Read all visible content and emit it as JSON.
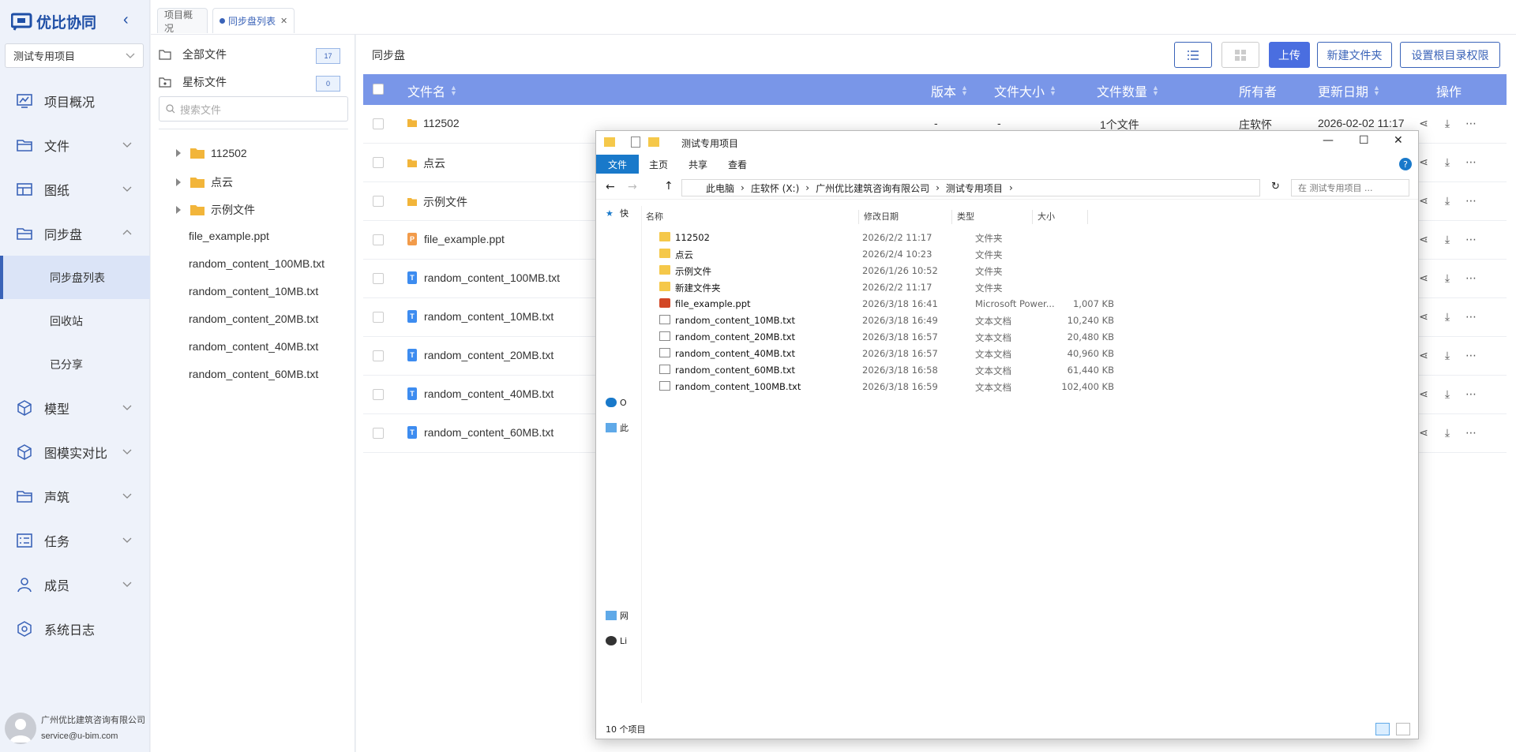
{
  "app": {
    "logo_text": "优比协同",
    "project": "测试专用项目"
  },
  "nav": [
    {
      "label": "项目概况",
      "icon": "chart-icon"
    },
    {
      "label": "文件",
      "icon": "folder-icon"
    },
    {
      "label": "图纸",
      "icon": "drawing-icon"
    },
    {
      "label": "同步盘",
      "icon": "sync-icon"
    },
    {
      "label": "模型",
      "icon": "cube-icon"
    },
    {
      "label": "图模实对比",
      "icon": "compare-icon"
    },
    {
      "label": "声筑",
      "icon": "sound-icon"
    },
    {
      "label": "任务",
      "icon": "task-icon"
    },
    {
      "label": "成员",
      "icon": "user-icon"
    },
    {
      "label": "系统日志",
      "icon": "log-icon"
    }
  ],
  "sync_sub": [
    "同步盘列表",
    "回收站",
    "已分享"
  ],
  "user": {
    "company": "广州优比建筑咨询有限公司",
    "email": "service@u-bim.com"
  },
  "tabs": [
    {
      "label": "项目概况"
    },
    {
      "label": "同步盘列表"
    }
  ],
  "tree": {
    "all_files": "全部文件",
    "all_count": "17",
    "starred": "星标文件",
    "starred_count": "0",
    "search_placeholder": "搜索文件",
    "nodes": [
      "112502",
      "点云",
      "示例文件"
    ],
    "files": [
      "file_example.ppt",
      "random_content_100MB.txt",
      "random_content_10MB.txt",
      "random_content_20MB.txt",
      "random_content_40MB.txt",
      "random_content_60MB.txt"
    ]
  },
  "main": {
    "breadcrumb": "同步盘",
    "btn_upload": "上传",
    "btn_new_folder": "新建文件夹",
    "btn_root_perm": "设置根目录权限",
    "headers": {
      "name": "文件名",
      "version": "版本",
      "size": "文件大小",
      "count": "文件数量",
      "owner": "所有者",
      "updated": "更新日期",
      "ops": "操作"
    },
    "row0": {
      "name": "112502",
      "version": "-",
      "size": "-",
      "count": "1个文件",
      "owner": "庄软怀",
      "updated": "2026-02-02 11:17"
    },
    "rows": [
      "点云",
      "示例文件",
      "file_example.ppt",
      "random_content_100MB.txt",
      "random_content_10MB.txt",
      "random_content_20MB.txt",
      "random_content_40MB.txt",
      "random_content_60MB.txt"
    ]
  },
  "explorer": {
    "title": "测试专用项目",
    "ribbon": [
      "文件",
      "主页",
      "共享",
      "查看"
    ],
    "path": [
      "此电脑",
      "庄软怀 (X:)",
      "广州优比建筑咨询有限公司",
      "测试专用项目"
    ],
    "search_placeholder": "在 测试专用项目 ...",
    "columns": {
      "name": "名称",
      "date": "修改日期",
      "type": "类型",
      "size": "大小"
    },
    "nav_labels": {
      "quick": "快",
      "onedrive": "O",
      "pc": "此",
      "network": "网",
      "linux": "Li"
    },
    "files": [
      {
        "name": "112502",
        "date": "2026/2/2 11:17",
        "type": "文件夹",
        "size": ""
      },
      {
        "name": "点云",
        "date": "2026/2/4 10:23",
        "type": "文件夹",
        "size": ""
      },
      {
        "name": "示例文件",
        "date": "2026/1/26 10:52",
        "type": "文件夹",
        "size": ""
      },
      {
        "name": "新建文件夹",
        "date": "2026/2/2 11:17",
        "type": "文件夹",
        "size": ""
      },
      {
        "name": "file_example.ppt",
        "date": "2026/3/18 16:41",
        "type": "Microsoft Power...",
        "size": "1,007 KB"
      },
      {
        "name": "random_content_10MB.txt",
        "date": "2026/3/18 16:49",
        "type": "文本文档",
        "size": "10,240 KB"
      },
      {
        "name": "random_content_20MB.txt",
        "date": "2026/3/18 16:57",
        "type": "文本文档",
        "size": "20,480 KB"
      },
      {
        "name": "random_content_40MB.txt",
        "date": "2026/3/18 16:57",
        "type": "文本文档",
        "size": "40,960 KB"
      },
      {
        "name": "random_content_60MB.txt",
        "date": "2026/3/18 16:58",
        "type": "文本文档",
        "size": "61,440 KB"
      },
      {
        "name": "random_content_100MB.txt",
        "date": "2026/3/18 16:59",
        "type": "文本文档",
        "size": "102,400 KB"
      }
    ],
    "status": "10 个项目"
  }
}
